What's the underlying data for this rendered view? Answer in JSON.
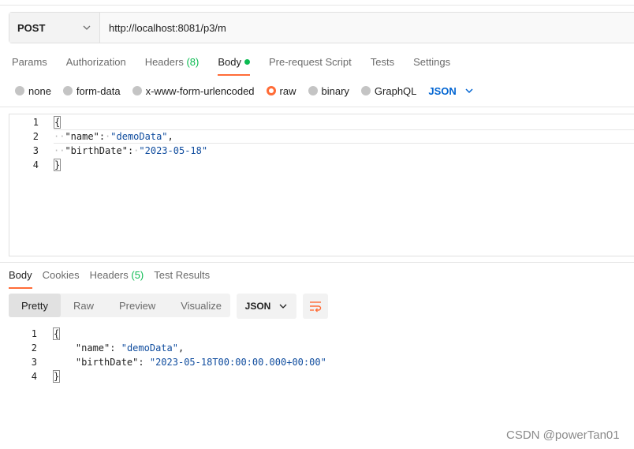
{
  "request": {
    "method": "POST",
    "url": "http://localhost:8081/p3/m"
  },
  "request_tabs": {
    "params": "Params",
    "authorization": "Authorization",
    "headers": "Headers",
    "headers_count": "(8)",
    "body": "Body",
    "prerequest": "Pre-request Script",
    "tests": "Tests",
    "settings": "Settings"
  },
  "body_types": {
    "none": "none",
    "form_data": "form-data",
    "urlencoded": "x-www-form-urlencoded",
    "raw": "raw",
    "binary": "binary",
    "graphql": "GraphQL",
    "selected": "raw",
    "format": "JSON"
  },
  "request_body": {
    "line_numbers": [
      "1",
      "2",
      "3",
      "4"
    ],
    "open_brace": "{",
    "close_brace": "}",
    "name_key": "\"name\"",
    "name_value": "\"demoData\"",
    "birth_key": "\"birthDate\"",
    "birth_value": "\"2023-05-18\""
  },
  "response_tabs": {
    "body": "Body",
    "cookies": "Cookies",
    "headers": "Headers",
    "headers_count": "(5)",
    "test_results": "Test Results"
  },
  "response_views": {
    "pretty": "Pretty",
    "raw": "Raw",
    "preview": "Preview",
    "visualize": "Visualize",
    "format": "JSON"
  },
  "response_body": {
    "line_numbers": [
      "1",
      "2",
      "3",
      "4"
    ],
    "open_brace": "{",
    "close_brace": "}",
    "name_key": "\"name\"",
    "name_value": "\"demoData\"",
    "birth_key": "\"birthDate\"",
    "birth_value": "\"2023-05-18T00:00:00.000+00:00\""
  },
  "watermark": "CSDN @powerTan01",
  "colors": {
    "accent": "#ff6c37",
    "success": "#0cbb52",
    "link": "#0265d2",
    "string": "#0f4c9e"
  }
}
